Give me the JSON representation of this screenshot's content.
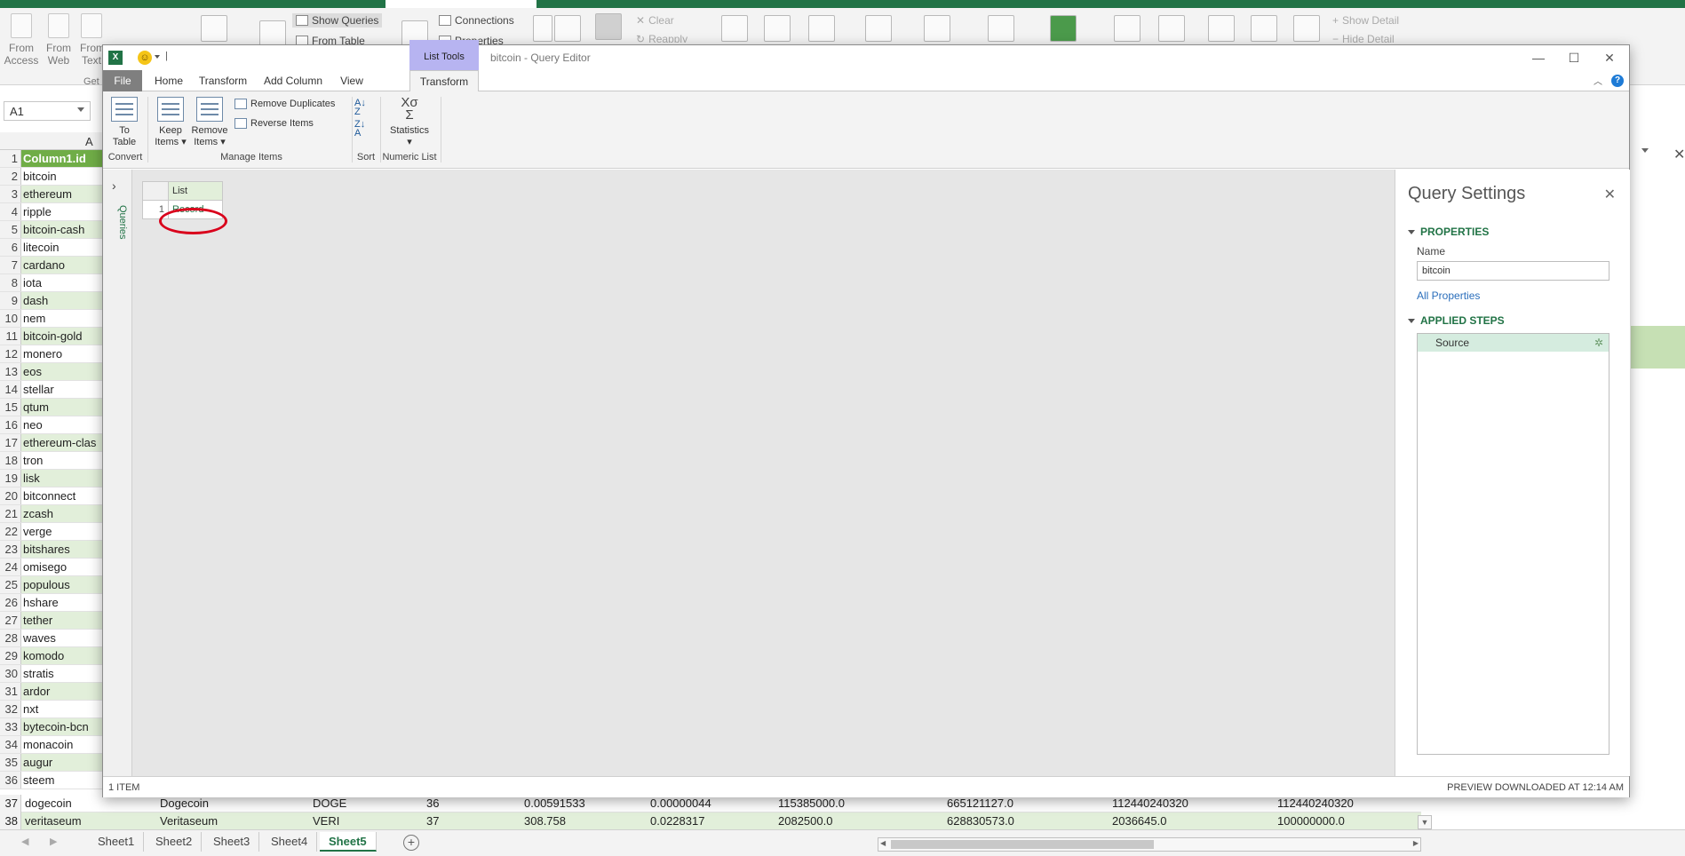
{
  "excel": {
    "ribbon": {
      "from_access": "From Access",
      "from_web": "From Web",
      "from_text": "From Text",
      "get_group": "Get",
      "show_queries": "Show Queries",
      "from_table": "From Table",
      "connections": "Connections",
      "properties": "Properties",
      "clear": "Clear",
      "reapply": "Reapply",
      "show_detail": "Show Detail",
      "hide_detail": "Hide Detail"
    },
    "name_box": "A1",
    "column_header": "A",
    "rows": [
      {
        "n": "1",
        "v": "Column1.id"
      },
      {
        "n": "2",
        "v": "bitcoin"
      },
      {
        "n": "3",
        "v": "ethereum"
      },
      {
        "n": "4",
        "v": "ripple"
      },
      {
        "n": "5",
        "v": "bitcoin-cash"
      },
      {
        "n": "6",
        "v": "litecoin"
      },
      {
        "n": "7",
        "v": "cardano"
      },
      {
        "n": "8",
        "v": "iota"
      },
      {
        "n": "9",
        "v": "dash"
      },
      {
        "n": "10",
        "v": "nem"
      },
      {
        "n": "11",
        "v": "bitcoin-gold"
      },
      {
        "n": "12",
        "v": "monero"
      },
      {
        "n": "13",
        "v": "eos"
      },
      {
        "n": "14",
        "v": "stellar"
      },
      {
        "n": "15",
        "v": "qtum"
      },
      {
        "n": "16",
        "v": "neo"
      },
      {
        "n": "17",
        "v": "ethereum-clas"
      },
      {
        "n": "18",
        "v": "tron"
      },
      {
        "n": "19",
        "v": "lisk"
      },
      {
        "n": "20",
        "v": "bitconnect"
      },
      {
        "n": "21",
        "v": "zcash"
      },
      {
        "n": "22",
        "v": "verge"
      },
      {
        "n": "23",
        "v": "bitshares"
      },
      {
        "n": "24",
        "v": "omisego"
      },
      {
        "n": "25",
        "v": "populous"
      },
      {
        "n": "26",
        "v": "hshare"
      },
      {
        "n": "27",
        "v": "tether"
      },
      {
        "n": "28",
        "v": "waves"
      },
      {
        "n": "29",
        "v": "komodo"
      },
      {
        "n": "30",
        "v": "stratis"
      },
      {
        "n": "31",
        "v": "ardor"
      },
      {
        "n": "32",
        "v": "nxt"
      },
      {
        "n": "33",
        "v": "bytecoin-bcn"
      },
      {
        "n": "34",
        "v": "monacoin"
      },
      {
        "n": "35",
        "v": "augur"
      },
      {
        "n": "36",
        "v": "steem"
      }
    ],
    "bottom_rows": [
      {
        "n": "37",
        "cells": [
          "dogecoin",
          "Dogecoin",
          "DOGE",
          "36",
          "0.00591533",
          "0.00000044",
          "115385000.0",
          "665121127.0",
          "112440240320",
          "112440240320"
        ]
      },
      {
        "n": "38",
        "cells": [
          "veritaseum",
          "Veritaseum",
          "VERI",
          "37",
          "308.758",
          "0.0228317",
          "2082500.0",
          "628830573.0",
          "2036645.0",
          "100000000.0"
        ]
      }
    ],
    "sheets": [
      "Sheet1",
      "Sheet2",
      "Sheet3",
      "Sheet4",
      "Sheet5"
    ],
    "add_sheet": "+"
  },
  "query_editor": {
    "caption": "bitcoin - Query Editor",
    "list_tools": "List Tools",
    "tabs": [
      "File",
      "Home",
      "Transform",
      "Add Column",
      "View",
      "Transform"
    ],
    "ribbon": {
      "to_table_1": "To",
      "to_table_2": "Table",
      "keep_items_1": "Keep",
      "keep_items_2": "Items ▾",
      "remove_items_1": "Remove",
      "remove_items_2": "Items ▾",
      "remove_duplicates": "Remove Duplicates",
      "reverse_items": "Reverse Items",
      "statistics": "Statistics",
      "statistics_dd": "▾",
      "groups": {
        "convert": "Convert",
        "manage_items": "Manage Items",
        "sort": "Sort",
        "numeric_list": "Numeric List"
      }
    },
    "queries_label": "Queries",
    "preview": {
      "column": "List",
      "rows": [
        {
          "n": "1",
          "v": "Record"
        }
      ]
    },
    "settings": {
      "title": "Query Settings",
      "properties": "PROPERTIES",
      "name_label": "Name",
      "name_value": "bitcoin",
      "all_properties": "All Properties",
      "applied_steps": "APPLIED STEPS",
      "steps": [
        "Source"
      ]
    },
    "status_left": "1 ITEM",
    "status_right": "PREVIEW DOWNLOADED AT 12:14 AM"
  },
  "colors": {
    "excel_green": "#217346",
    "table_header": "#70ad47",
    "table_band": "#e2efda",
    "list_tools": "#b7b4f1",
    "highlight_ellipse": "#d9001b"
  }
}
